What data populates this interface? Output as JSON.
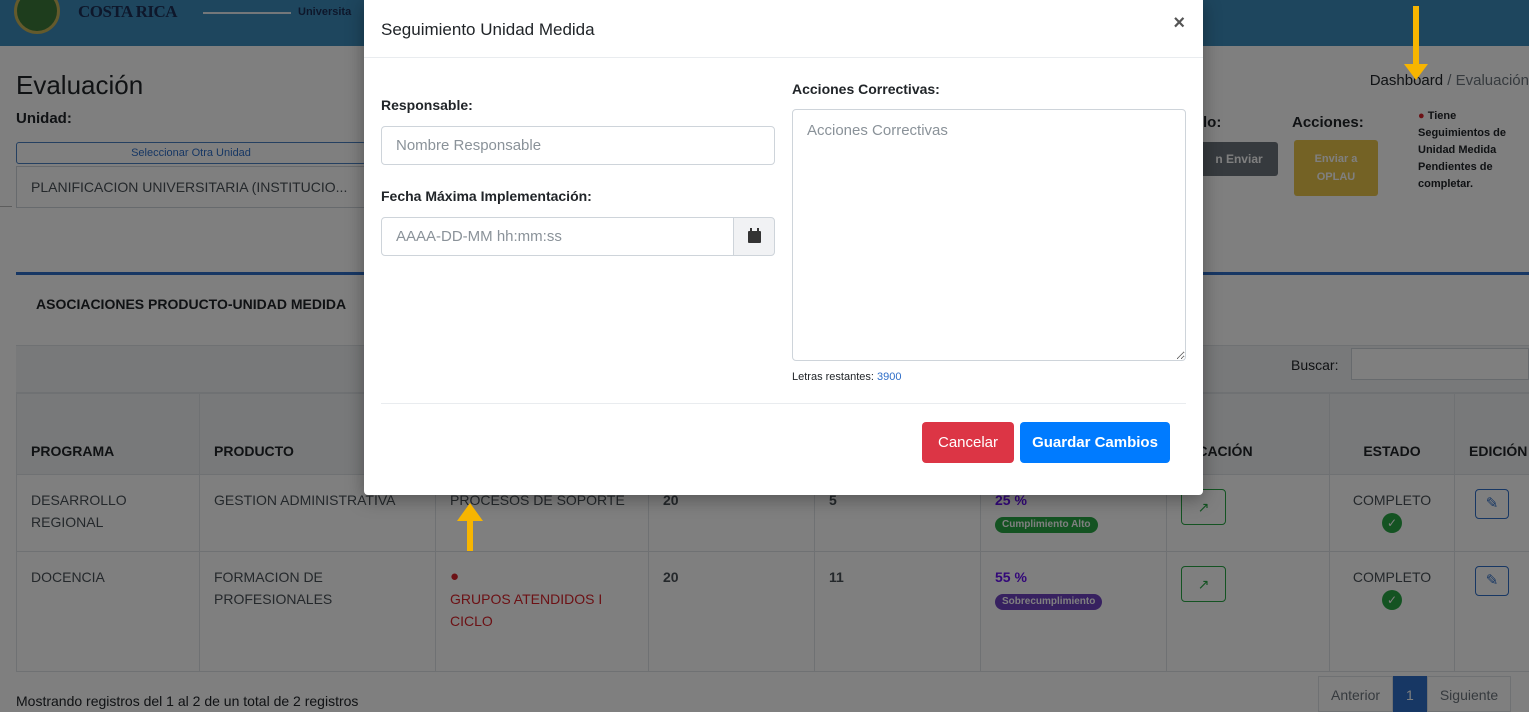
{
  "header": {
    "logo_text": "COSTA RICA",
    "logo_sub": "Universita"
  },
  "page": {
    "title": "Evaluación",
    "breadcrumb": {
      "home": "Dashboard",
      "separator": "/",
      "current": "Evaluación"
    },
    "unidad_label": "Unidad:",
    "select_other": "Seleccionar Otra Unidad",
    "unit_value": "PLANIFICACION UNIVERSITARIA (INSTITUCIO...",
    "right_label_partial": "lo:",
    "acciones_label": "Acciones:",
    "sin_enviar_label": "n Enviar",
    "enviar_label": "Enviar a OPLAU",
    "seguimientos_note": "Tiene Seguimientos de Unidad Medida Pendientes de completar.",
    "card_title": "ASOCIACIONES PRODUCTO-UNIDAD MEDIDA",
    "search_label": "Buscar:"
  },
  "table": {
    "headers": [
      "PROGRAMA",
      "PRODUCTO",
      "",
      "",
      "",
      "",
      "IFICACIÓN",
      "ESTADO",
      "EDICIÓN"
    ],
    "rows": [
      {
        "programa": "DESARROLLO REGIONAL",
        "producto": "GESTION ADMINISTRATIVA",
        "indicador": "PROCESOS DE SOPORTE",
        "meta": "20",
        "logro": "5",
        "pct": "25 %",
        "badge": "Cumplimiento Alto",
        "estado": "COMPLETO"
      },
      {
        "programa": "DOCENCIA",
        "producto": "FORMACION DE PROFESIONALES",
        "indicador": "GRUPOS ATENDIDOS I CICLO",
        "meta": "20",
        "logro": "11",
        "pct": "55 %",
        "badge": "Sobrecumplimiento",
        "estado": "COMPLETO"
      }
    ]
  },
  "footer": {
    "info": "Mostrando registros del 1 al 2 de un total de 2 registros",
    "prev": "Anterior",
    "page": "1",
    "next": "Siguiente"
  },
  "modal": {
    "title": "Seguimiento Unidad Medida",
    "close": "×",
    "responsable_label": "Responsable:",
    "responsable_placeholder": "Nombre Responsable",
    "fecha_label": "Fecha Máxima Implementación:",
    "fecha_placeholder": "AAAA-DD-MM hh:mm:ss",
    "acciones_label": "Acciones Correctivas:",
    "acciones_placeholder": "Acciones Correctivas",
    "letras_label": "Letras restantes:",
    "letras_count": "3900",
    "cancel_label": "Cancelar",
    "save_label": "Guardar Cambios"
  },
  "colors": {
    "primary": "#007bff",
    "danger": "#dc3545",
    "success": "#28a745",
    "warning": "#e9c54a",
    "accent_arrow": "#f7b500"
  }
}
